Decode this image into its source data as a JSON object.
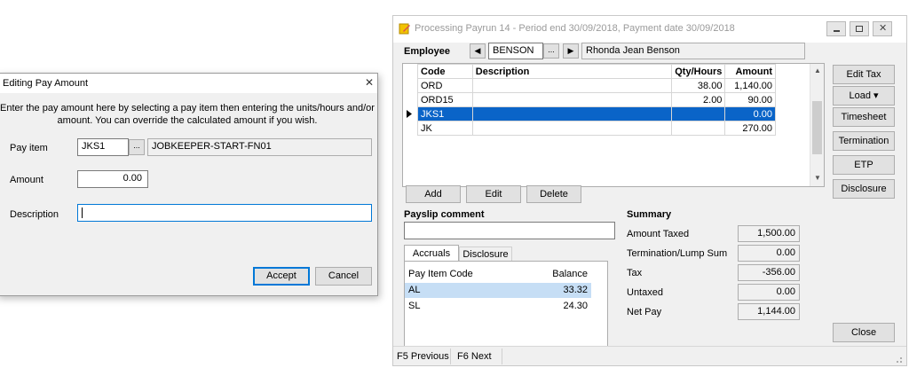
{
  "main_window": {
    "title": "Processing Payrun 14 - Period end 30/09/2018, Payment date 30/09/2018",
    "employee_label": "Employee",
    "employee_code": "BENSON",
    "employee_name": "Rhonda Jean Benson",
    "ellipsis": "...",
    "prev_arrow": "◀",
    "next_arrow": "▶",
    "grid": {
      "headers": [
        "Code",
        "Description",
        "Qty/Hours",
        "Amount"
      ],
      "rows": [
        {
          "code": "ORD",
          "description": "",
          "qty": "38.00",
          "amount": "1,140.00",
          "selected": false
        },
        {
          "code": "ORD15",
          "description": "",
          "qty": "2.00",
          "amount": "90.00",
          "selected": false
        },
        {
          "code": "JKS1",
          "description": "",
          "qty": "",
          "amount": "0.00",
          "selected": true
        },
        {
          "code": "JK",
          "description": "",
          "qty": "",
          "amount": "270.00",
          "selected": false
        }
      ]
    },
    "row_buttons": {
      "add": "Add",
      "edit": "Edit",
      "delete": "Delete"
    },
    "side_buttons": {
      "edit_tax": "Edit Tax",
      "load": "Load ▾",
      "timesheet": "Timesheet",
      "termination": "Termination",
      "etp": "ETP",
      "disclosure": "Disclosure",
      "close": "Close"
    },
    "payslip_comment_label": "Payslip comment",
    "payslip_comment_value": "",
    "tabs": [
      "Accruals",
      "Disclosure"
    ],
    "accruals": {
      "headers": [
        "Pay Item Code",
        "Balance"
      ],
      "rows": [
        {
          "code": "AL",
          "balance": "33.32",
          "selected": true
        },
        {
          "code": "SL",
          "balance": "24.30",
          "selected": false
        }
      ]
    },
    "summary": {
      "title": "Summary",
      "amount_taxed_label": "Amount Taxed",
      "amount_taxed": "1,500.00",
      "termination_label": "Termination/Lump Sum",
      "termination": "0.00",
      "tax_label": "Tax",
      "tax": "-356.00",
      "untaxed_label": "Untaxed",
      "untaxed": "0.00",
      "net_pay_label": "Net Pay",
      "net_pay": "1,144.00"
    },
    "status_bar": {
      "prev": "F5 Previous",
      "next": "F6 Next"
    }
  },
  "dialog": {
    "title": "Editing Pay Amount",
    "close_glyph": "✕",
    "instructions_line1": "Enter the pay amount here by selecting a pay item then entering the units/hours and/or",
    "instructions_line2": "amount. You can override the calculated amount if you wish.",
    "pay_item_label": "Pay item",
    "pay_item_code": "JKS1",
    "pay_item_name": "JOBKEEPER-START-FN01",
    "ellipsis": "...",
    "amount_label": "Amount",
    "amount_value": "0.00",
    "description_label": "Description",
    "description_value": "",
    "accept": "Accept",
    "cancel": "Cancel"
  },
  "colors": {
    "selection": "#0a64c8",
    "accrual_selection": "#c6def5",
    "window_bg": "#f0f0f0",
    "focus_border": "#0078d7"
  }
}
